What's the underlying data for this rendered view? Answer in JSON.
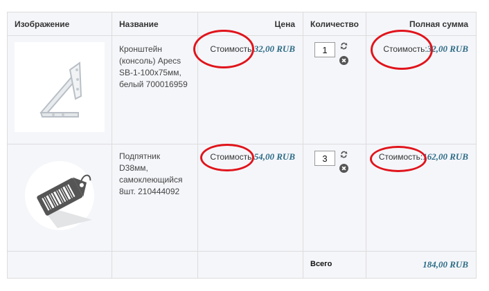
{
  "headers": {
    "image": "Изображение",
    "name": "Название",
    "price": "Цена",
    "quantity": "Количество",
    "total": "Полная сумма"
  },
  "items": [
    {
      "name_lines": [
        "Кронштейн",
        "(консоль) Apecs",
        "SB-1-100x75мм,",
        "белый 700016959"
      ],
      "price_label": "Стоимость:",
      "price_value": "32,00 RUB",
      "quantity": "1",
      "total_label": "Стоимость:",
      "total_value": "32,00 RUB"
    },
    {
      "name_lines": [
        "Подпятник",
        "D38мм,",
        "самоклеющийся",
        "8шт. 210444092"
      ],
      "price_label": "Стоимость:",
      "price_value": "54,00 RUB",
      "quantity": "3",
      "total_label": "Стоимость:",
      "total_value": "162,00 RUB"
    }
  ],
  "summary": {
    "label": "Всего",
    "value": "184,00 RUB"
  },
  "icons": {
    "update": "refresh-icon",
    "remove": "remove-icon",
    "placeholder": "price-tag-icon"
  },
  "colors": {
    "price": "#2d6c86",
    "highlight": "#e0141b",
    "border": "#dcdcdc",
    "background": "#f5f6fa"
  }
}
